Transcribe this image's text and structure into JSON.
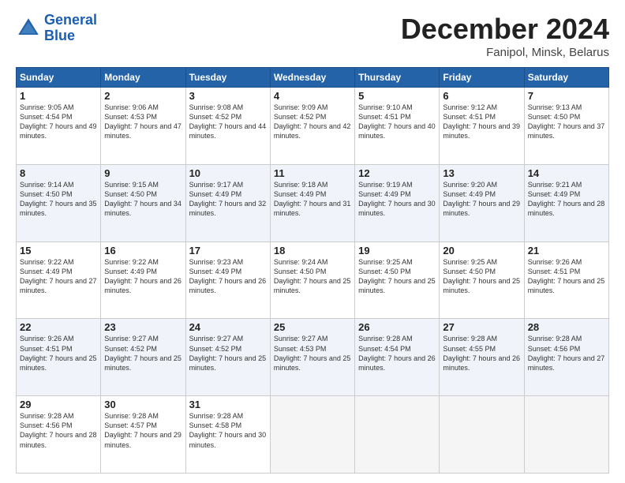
{
  "header": {
    "logo_line1": "General",
    "logo_line2": "Blue",
    "month_title": "December 2024",
    "location": "Fanipol, Minsk, Belarus"
  },
  "weekdays": [
    "Sunday",
    "Monday",
    "Tuesday",
    "Wednesday",
    "Thursday",
    "Friday",
    "Saturday"
  ],
  "weeks": [
    [
      {
        "day": "1",
        "sunrise": "9:05 AM",
        "sunset": "4:54 PM",
        "daylight": "7 hours and 49 minutes."
      },
      {
        "day": "2",
        "sunrise": "9:06 AM",
        "sunset": "4:53 PM",
        "daylight": "7 hours and 47 minutes."
      },
      {
        "day": "3",
        "sunrise": "9:08 AM",
        "sunset": "4:52 PM",
        "daylight": "7 hours and 44 minutes."
      },
      {
        "day": "4",
        "sunrise": "9:09 AM",
        "sunset": "4:52 PM",
        "daylight": "7 hours and 42 minutes."
      },
      {
        "day": "5",
        "sunrise": "9:10 AM",
        "sunset": "4:51 PM",
        "daylight": "7 hours and 40 minutes."
      },
      {
        "day": "6",
        "sunrise": "9:12 AM",
        "sunset": "4:51 PM",
        "daylight": "7 hours and 39 minutes."
      },
      {
        "day": "7",
        "sunrise": "9:13 AM",
        "sunset": "4:50 PM",
        "daylight": "7 hours and 37 minutes."
      }
    ],
    [
      {
        "day": "8",
        "sunrise": "9:14 AM",
        "sunset": "4:50 PM",
        "daylight": "7 hours and 35 minutes."
      },
      {
        "day": "9",
        "sunrise": "9:15 AM",
        "sunset": "4:50 PM",
        "daylight": "7 hours and 34 minutes."
      },
      {
        "day": "10",
        "sunrise": "9:17 AM",
        "sunset": "4:49 PM",
        "daylight": "7 hours and 32 minutes."
      },
      {
        "day": "11",
        "sunrise": "9:18 AM",
        "sunset": "4:49 PM",
        "daylight": "7 hours and 31 minutes."
      },
      {
        "day": "12",
        "sunrise": "9:19 AM",
        "sunset": "4:49 PM",
        "daylight": "7 hours and 30 minutes."
      },
      {
        "day": "13",
        "sunrise": "9:20 AM",
        "sunset": "4:49 PM",
        "daylight": "7 hours and 29 minutes."
      },
      {
        "day": "14",
        "sunrise": "9:21 AM",
        "sunset": "4:49 PM",
        "daylight": "7 hours and 28 minutes."
      }
    ],
    [
      {
        "day": "15",
        "sunrise": "9:22 AM",
        "sunset": "4:49 PM",
        "daylight": "7 hours and 27 minutes."
      },
      {
        "day": "16",
        "sunrise": "9:22 AM",
        "sunset": "4:49 PM",
        "daylight": "7 hours and 26 minutes."
      },
      {
        "day": "17",
        "sunrise": "9:23 AM",
        "sunset": "4:49 PM",
        "daylight": "7 hours and 26 minutes."
      },
      {
        "day": "18",
        "sunrise": "9:24 AM",
        "sunset": "4:50 PM",
        "daylight": "7 hours and 25 minutes."
      },
      {
        "day": "19",
        "sunrise": "9:25 AM",
        "sunset": "4:50 PM",
        "daylight": "7 hours and 25 minutes."
      },
      {
        "day": "20",
        "sunrise": "9:25 AM",
        "sunset": "4:50 PM",
        "daylight": "7 hours and 25 minutes."
      },
      {
        "day": "21",
        "sunrise": "9:26 AM",
        "sunset": "4:51 PM",
        "daylight": "7 hours and 25 minutes."
      }
    ],
    [
      {
        "day": "22",
        "sunrise": "9:26 AM",
        "sunset": "4:51 PM",
        "daylight": "7 hours and 25 minutes."
      },
      {
        "day": "23",
        "sunrise": "9:27 AM",
        "sunset": "4:52 PM",
        "daylight": "7 hours and 25 minutes."
      },
      {
        "day": "24",
        "sunrise": "9:27 AM",
        "sunset": "4:52 PM",
        "daylight": "7 hours and 25 minutes."
      },
      {
        "day": "25",
        "sunrise": "9:27 AM",
        "sunset": "4:53 PM",
        "daylight": "7 hours and 25 minutes."
      },
      {
        "day": "26",
        "sunrise": "9:28 AM",
        "sunset": "4:54 PM",
        "daylight": "7 hours and 26 minutes."
      },
      {
        "day": "27",
        "sunrise": "9:28 AM",
        "sunset": "4:55 PM",
        "daylight": "7 hours and 26 minutes."
      },
      {
        "day": "28",
        "sunrise": "9:28 AM",
        "sunset": "4:56 PM",
        "daylight": "7 hours and 27 minutes."
      }
    ],
    [
      {
        "day": "29",
        "sunrise": "9:28 AM",
        "sunset": "4:56 PM",
        "daylight": "7 hours and 28 minutes."
      },
      {
        "day": "30",
        "sunrise": "9:28 AM",
        "sunset": "4:57 PM",
        "daylight": "7 hours and 29 minutes."
      },
      {
        "day": "31",
        "sunrise": "9:28 AM",
        "sunset": "4:58 PM",
        "daylight": "7 hours and 30 minutes."
      },
      null,
      null,
      null,
      null
    ]
  ]
}
